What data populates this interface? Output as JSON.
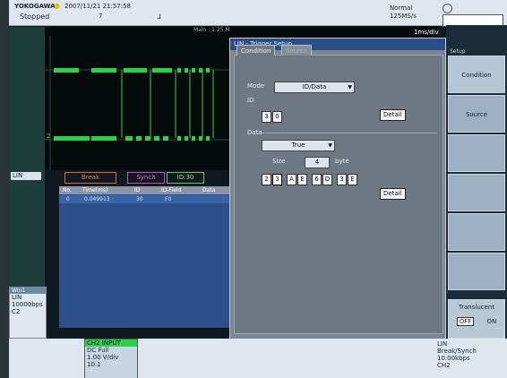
{
  "top": {
    "brand": "YOKOGAWA",
    "datetime": "2007/11/21 21:57:58",
    "status": "Stopped",
    "mark7": "7",
    "acq_mode": "Normal",
    "sample_rate": "125MS/s",
    "time_div": "1ms/div",
    "main_len": "Main : 1.25 M"
  },
  "left": {
    "lin_label": "LIN",
    "win_title": "Win1",
    "win_line1": "LIN",
    "win_line2": "10000bps",
    "win_line3": "C2"
  },
  "decode": {
    "break_label": "Break",
    "synch_label": "Synch",
    "id_label": "ID:30"
  },
  "list": {
    "headers": [
      "No.",
      "Time(ms)",
      "ID",
      "ID-Field",
      "Data"
    ],
    "row1": {
      "no": "0",
      "time": "0.049913",
      "id": "30",
      "idfield": "F0"
    }
  },
  "dialog": {
    "title": "LIN - Trigger Setup",
    "tab_condition": "Condition",
    "tab_source": "Source",
    "mode_label": "Mode",
    "mode_value": "ID/Data",
    "id_label": "ID",
    "id_d1": "3",
    "id_d2": "0",
    "detail1": "Detail",
    "data_label": "Data",
    "data_value": "True",
    "size_label": "Size",
    "size_value": "4",
    "size_unit": "byte",
    "data_digits": [
      "2",
      "3",
      "A",
      "E",
      "6",
      "D",
      "3",
      "E"
    ],
    "detail2": "Detail"
  },
  "right": {
    "setup_label": "Setup",
    "condition_label": "Condition",
    "source_label": "Source",
    "translucent_label": "Translucent",
    "off_label": "OFF",
    "on_label": "ON"
  },
  "bottom": {
    "ch_title": "CH2 INPUT",
    "ch_line1": "DC Full",
    "ch_line2": "1.00 V/div",
    "ch_line3": "10:1",
    "trig_line1": "LIN",
    "trig_line2": "Break/Synch",
    "trig_line3": "10.00kbps",
    "trig_line4": "CH2"
  },
  "colors": {
    "trace": "#2cd14a",
    "dialog_title": "#2a4e88",
    "list_bg": "#2d4f8c"
  }
}
